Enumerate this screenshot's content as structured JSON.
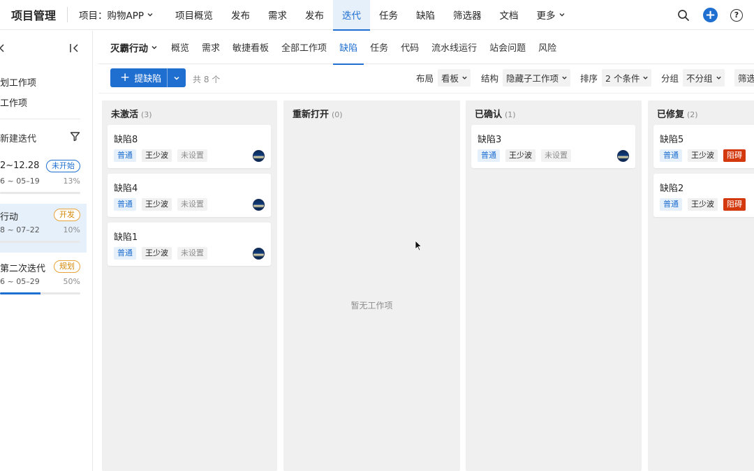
{
  "topnav": {
    "brand": "项目管理",
    "project_label": "项目：购物APP",
    "items": [
      {
        "label": "项目概览"
      },
      {
        "label": "发布"
      },
      {
        "label": "需求"
      },
      {
        "label": "发布"
      },
      {
        "label": "迭代",
        "active": true
      },
      {
        "label": "任务"
      },
      {
        "label": "缺陷"
      },
      {
        "label": "筛选器"
      },
      {
        "label": "文档"
      },
      {
        "label": "更多"
      }
    ]
  },
  "sidebar": {
    "links": [
      "划工作项",
      "工作项"
    ],
    "new_iteration": "新建迭代",
    "iterations": [
      {
        "name": "2~12.28",
        "dates": "6 ~ 05–19",
        "badge": "未开始",
        "badge_color": "#1f6fd1",
        "progress_label": "13%",
        "progress": 0
      },
      {
        "name": "行动",
        "dates": "8 ~ 07–22",
        "badge": "开发",
        "badge_color": "#d48806",
        "progress_label": "10%",
        "progress": 0,
        "selected": true
      },
      {
        "name": "第二次迭代",
        "dates": "6 ~ 05–29",
        "badge": "规划",
        "badge_color": "#d48806",
        "progress_label": "50%",
        "progress": 0.5
      }
    ]
  },
  "subnav": {
    "iteration_title": "灭霸行动",
    "tabs": [
      "概览",
      "需求",
      "敏捷看板",
      "全部工作项",
      "缺陷",
      "任务",
      "代码",
      "流水线运行",
      "站会问题",
      "风险"
    ],
    "active_tab": "缺陷"
  },
  "toolbar": {
    "add_label": "提缺陷",
    "count": "共 8 个",
    "layout_label": "布局",
    "layout_value": "看板",
    "structure_label": "结构",
    "structure_value": "隐藏子工作项",
    "sort_label": "排序",
    "sort_value": "2 个条件",
    "group_label": "分组",
    "group_value": "不分组",
    "filter_label": "筛选"
  },
  "board": {
    "empty_text": "暂无工作项",
    "columns": [
      {
        "title": "未激活",
        "count": "(3)",
        "cards": [
          {
            "title": "缺陷8",
            "type": "普通",
            "owner": "王少波",
            "third": "未设置"
          },
          {
            "title": "缺陷4",
            "type": "普通",
            "owner": "王少波",
            "third": "未设置"
          },
          {
            "title": "缺陷1",
            "type": "普通",
            "owner": "王少波",
            "third": "未设置"
          }
        ]
      },
      {
        "title": "重新打开",
        "count": "(0)",
        "cards": []
      },
      {
        "title": "已确认",
        "count": "(1)",
        "cards": [
          {
            "title": "缺陷3",
            "type": "普通",
            "owner": "王少波",
            "third": "未设置"
          }
        ]
      },
      {
        "title": "已修复",
        "count": "(2)",
        "cards": [
          {
            "title": "缺陷5",
            "type": "普通",
            "owner": "王少波",
            "third": "阻碍"
          },
          {
            "title": "缺陷2",
            "type": "普通",
            "owner": "王少波",
            "third": "阻碍"
          }
        ]
      }
    ]
  },
  "colors": {
    "accent": "#1f6fd1",
    "block": "#d4380d",
    "dev_badge": "#d48806"
  }
}
